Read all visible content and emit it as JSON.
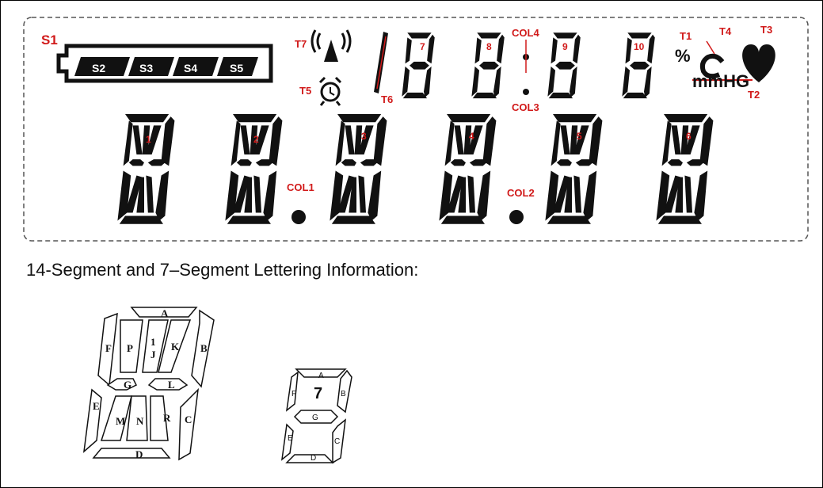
{
  "lcd_labels": {
    "S1": "S1",
    "S2": "S2",
    "S3": "S3",
    "S4": "S4",
    "S5": "S5",
    "T1": "T1",
    "T2": "T2",
    "T3": "T3",
    "T4": "T4",
    "T5": "T5",
    "T6": "T6",
    "T7": "T7",
    "COL1": "COL1",
    "COL2": "COL2",
    "COL3": "COL3",
    "COL4": "COL4",
    "d1": "1",
    "d2": "2",
    "d3": "3",
    "d4": "4",
    "d5": "5",
    "d6": "6",
    "d7": "7",
    "d8": "8",
    "d9": "9",
    "d10": "10",
    "percent": "%",
    "celsius": "C",
    "mmhg": "mmHG"
  },
  "caption": "14-Segment and 7–Segment Lettering Information:",
  "seg14_letters": {
    "A": "A",
    "B": "B",
    "C": "C",
    "D": "D",
    "E": "E",
    "F": "F",
    "G": "G",
    "L": "L",
    "P": "P",
    "K": "K",
    "M": "M",
    "N": "N",
    "R": "R",
    "one": "1",
    "J": "J"
  },
  "seg7_letters": {
    "A": "A",
    "B": "B",
    "C": "C",
    "D": "D",
    "E": "E",
    "F": "F",
    "G": "G",
    "seven": "7"
  },
  "colors": {
    "segment": "#111111",
    "label": "#d11a1a",
    "border": "#555555"
  }
}
